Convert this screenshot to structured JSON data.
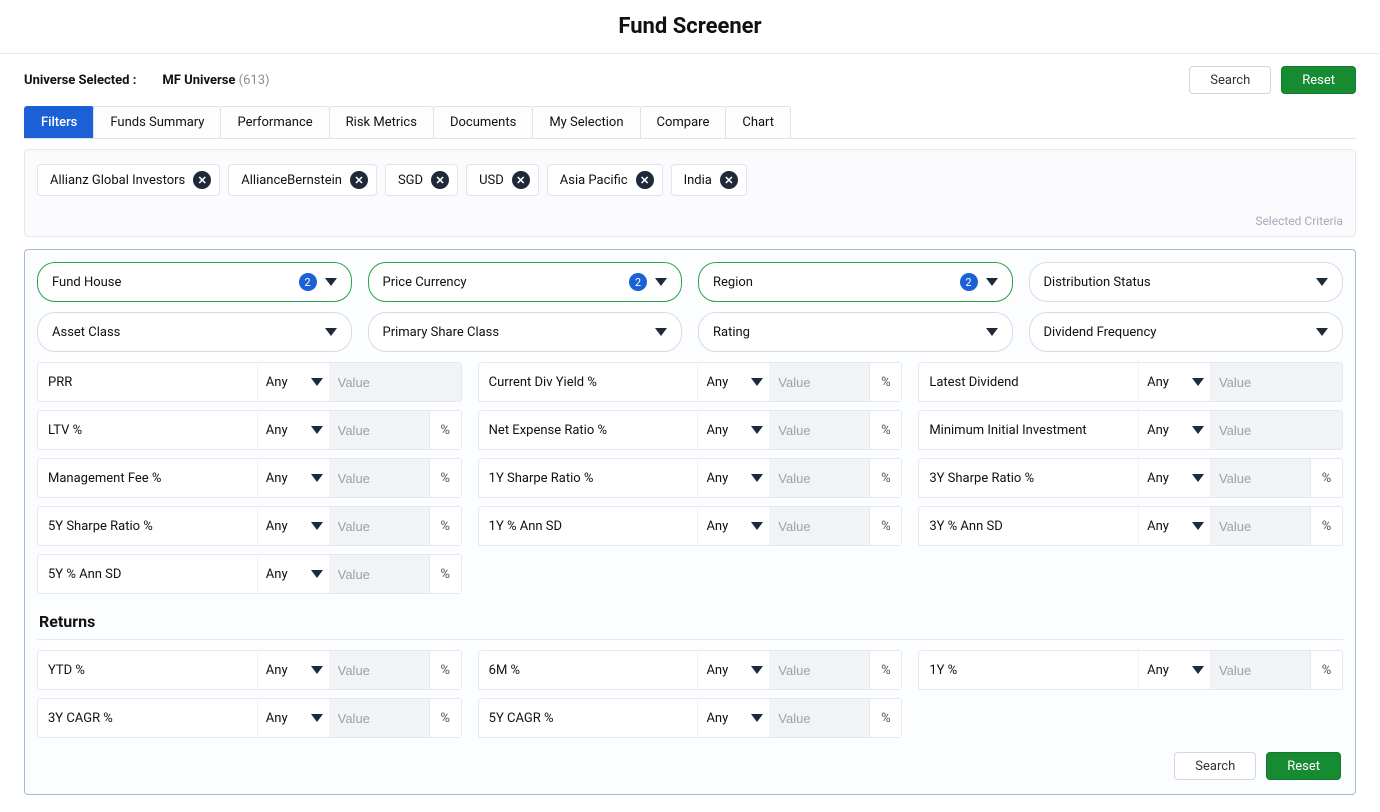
{
  "page_title": "Fund Screener",
  "universe_label": "Universe Selected :",
  "universe_name": "MF Universe",
  "universe_count": "(613)",
  "btn_search": "Search",
  "btn_reset": "Reset",
  "tabs": [
    "Filters",
    "Funds Summary",
    "Performance",
    "Risk Metrics",
    "Documents",
    "My Selection",
    "Compare",
    "Chart"
  ],
  "active_tab_index": 0,
  "chips": [
    "Allianz Global Investors",
    "AllianceBernstein",
    "SGD",
    "USD",
    "Asia Pacific",
    "India"
  ],
  "selected_criteria_caption": "Selected Criteria",
  "dropdowns_top": [
    {
      "label": "Fund House",
      "badge": "2",
      "hot": true
    },
    {
      "label": "Price Currency",
      "badge": "2",
      "hot": true
    },
    {
      "label": "Region",
      "badge": "2",
      "hot": true
    },
    {
      "label": "Distribution Status",
      "badge": null,
      "hot": false
    }
  ],
  "dropdowns_second": [
    {
      "label": "Asset Class",
      "badge": null,
      "hot": false
    },
    {
      "label": "Primary Share Class",
      "badge": null,
      "hot": false
    },
    {
      "label": "Rating",
      "badge": null,
      "hot": false
    },
    {
      "label": "Dividend Frequency",
      "badge": null,
      "hot": false
    }
  ],
  "condition_label": "Any",
  "value_placeholder": "Value",
  "metrics_rows": [
    [
      {
        "label": "PRR",
        "pct": false
      },
      {
        "label": "Current Div Yield %",
        "pct": true
      },
      {
        "label": "Latest Dividend",
        "pct": false
      }
    ],
    [
      {
        "label": "LTV %",
        "pct": true
      },
      {
        "label": "Net Expense Ratio %",
        "pct": true
      },
      {
        "label": "Minimum Initial Investment",
        "pct": false
      }
    ],
    [
      {
        "label": "Management Fee %",
        "pct": true
      },
      {
        "label": "1Y Sharpe Ratio %",
        "pct": true
      },
      {
        "label": "3Y Sharpe Ratio %",
        "pct": true
      }
    ],
    [
      {
        "label": "5Y Sharpe Ratio %",
        "pct": true
      },
      {
        "label": "1Y % Ann SD",
        "pct": true
      },
      {
        "label": "3Y % Ann SD",
        "pct": true
      }
    ],
    [
      {
        "label": "5Y % Ann SD",
        "pct": true
      },
      null,
      null
    ]
  ],
  "returns_title": "Returns",
  "returns_rows": [
    [
      {
        "label": "YTD %",
        "pct": true
      },
      {
        "label": "6M %",
        "pct": true
      },
      {
        "label": "1Y %",
        "pct": true
      }
    ],
    [
      {
        "label": "3Y CAGR %",
        "pct": true
      },
      {
        "label": "5Y CAGR %",
        "pct": true
      },
      null
    ]
  ]
}
